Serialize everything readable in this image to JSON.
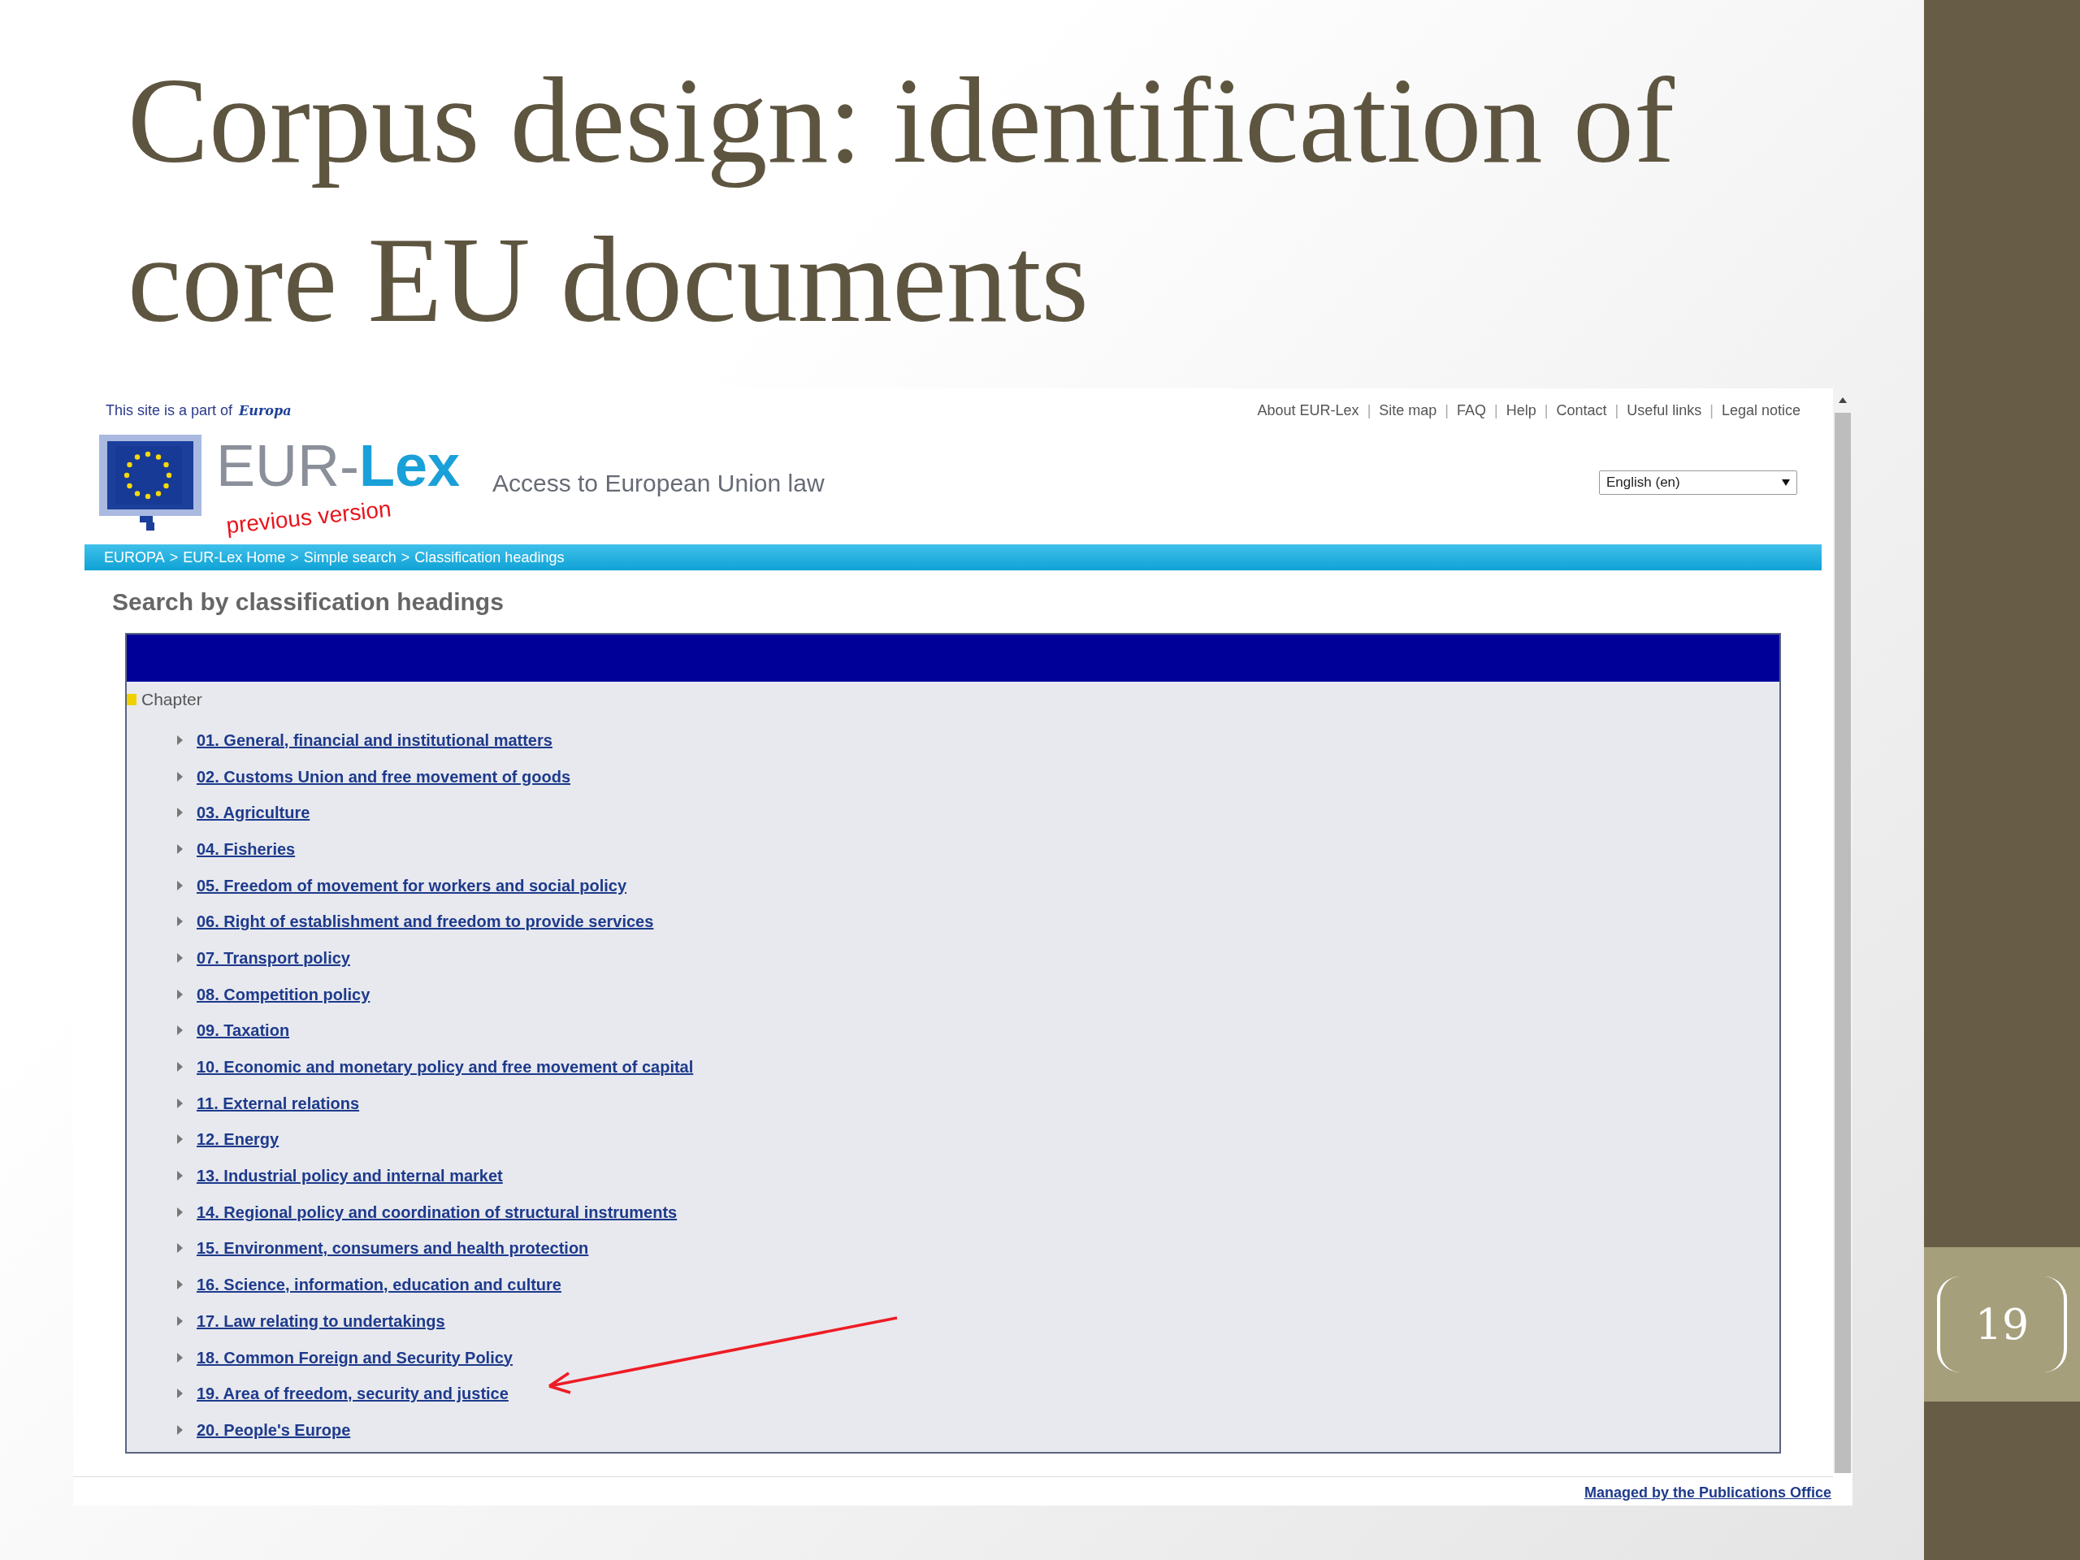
{
  "slide": {
    "title": "Corpus design: identification of core EU documents",
    "page_number": "19"
  },
  "site": {
    "part_of": "This site is a part of",
    "europa_logo": "Europa",
    "top_links": [
      "About EUR-Lex",
      "Site map",
      "FAQ",
      "Help",
      "Contact",
      "Useful links",
      "Legal notice"
    ],
    "link_separator": "|",
    "logo": {
      "name_a": "EUR-",
      "name_b": "Lex",
      "overlay": "previous version"
    },
    "tagline": "Access to European Union law",
    "language": "English (en)",
    "breadcrumb": [
      "EUROPA",
      "EUR-Lex Home",
      "Simple search",
      "Classification headings"
    ],
    "breadcrumb_separator": ">",
    "heading": "Search by classification headings",
    "tree": {
      "root": "Chapter",
      "items": [
        {
          "label": "01. General, financial and institutional matters",
          "expanded": false
        },
        {
          "label": "02. Customs Union and free movement of goods",
          "expanded": false
        },
        {
          "label": "03. Agriculture",
          "expanded": false
        },
        {
          "label": "04. Fisheries",
          "expanded": false
        },
        {
          "label": "05. Freedom of movement for workers and social policy",
          "expanded": false
        },
        {
          "label": "06. Right of establishment and freedom to provide services",
          "expanded": false
        },
        {
          "label": "07. Transport policy",
          "expanded": false
        },
        {
          "label": "08. Competition policy",
          "expanded": false
        },
        {
          "label": "09. Taxation",
          "expanded": false
        },
        {
          "label": "10. Economic and monetary policy and free movement of capital",
          "expanded": false
        },
        {
          "label": "11. External relations",
          "expanded": false
        },
        {
          "label": "12. Energy",
          "expanded": false
        },
        {
          "label": "13. Industrial policy and internal market",
          "expanded": false
        },
        {
          "label": "14. Regional policy and coordination of structural instruments",
          "expanded": false
        },
        {
          "label": "15. Environment, consumers and health protection",
          "expanded": false
        },
        {
          "label": "16. Science, information, education and culture",
          "expanded": false
        },
        {
          "label": "17. Law relating to undertakings",
          "expanded": false
        },
        {
          "label": "18. Common Foreign and Security Policy",
          "expanded": false
        },
        {
          "label": "19. Area of freedom, security and justice",
          "expanded": false
        },
        {
          "label": "20. People's Europe",
          "expanded": false
        }
      ]
    },
    "footer_link": "Managed by the Publications Office"
  }
}
